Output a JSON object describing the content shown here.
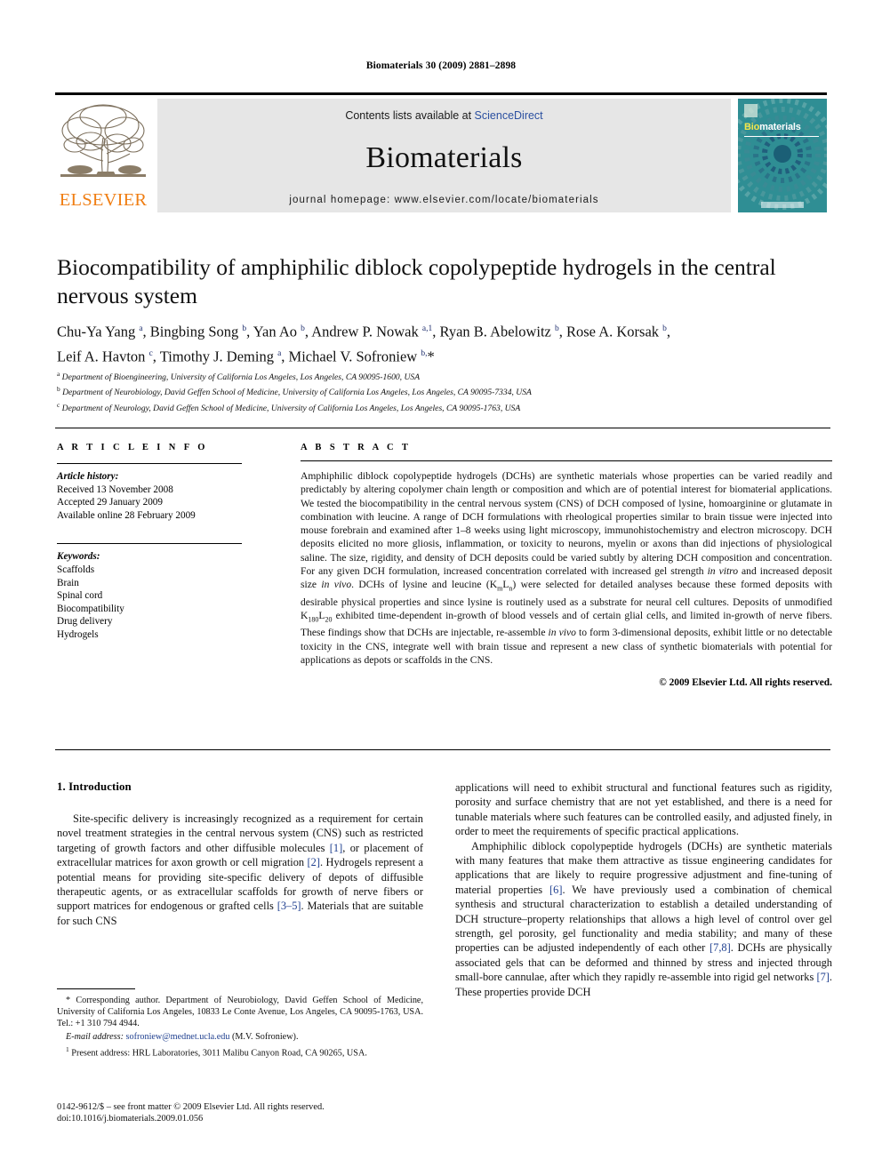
{
  "running_head": "Biomaterials 30 (2009) 2881–2898",
  "masthead": {
    "contents_prefix": "Contents lists available at ",
    "sciencedirect": "ScienceDirect",
    "journal_name": "Biomaterials",
    "homepage": "journal homepage: www.elsevier.com/locate/biomaterials",
    "publisher_logo_text": "ELSEVIER",
    "cover_title_part1": "Bio",
    "cover_title_part2": "materials",
    "accent_orange": "#F07E13",
    "link_blue": "#2a4fa0",
    "cover_teal": "#2a8f93"
  },
  "article": {
    "title": "Biocompatibility of amphiphilic diblock copolypeptide hydrogels in the central nervous system",
    "authors_line1": "Chu-Ya Yang <sup>a</sup>, Bingbing Song <sup>b</sup>, Yan Ao <sup>b</sup>, Andrew P. Nowak <sup>a,1</sup>, Ryan B. Abelowitz <sup>b</sup>, Rose A. Korsak <sup>b</sup>,",
    "authors_line2": "Leif A. Havton <sup>c</sup>, Timothy J. Deming <sup>a</sup>, Michael V. Sofroniew <sup>b,</sup>*",
    "affiliations": [
      "<sup>a</sup> Department of Bioengineering, University of California Los Angeles, Los Angeles, CA 90095-1600, USA",
      "<sup>b</sup> Department of Neurobiology, David Geffen School of Medicine, University of California Los Angeles, Los Angeles, CA 90095-7334, USA",
      "<sup>c</sup> Department of Neurology, David Geffen School of Medicine, University of California Los Angeles, Los Angeles, CA 90095-1763, USA"
    ]
  },
  "article_info": {
    "heading": "A R T I C L E   I N F O",
    "history_label": "Article history:",
    "history": [
      "Received 13 November 2008",
      "Accepted 29 January 2009",
      "Available online 28 February 2009"
    ],
    "keywords_label": "Keywords:",
    "keywords": [
      "Scaffolds",
      "Brain",
      "Spinal cord",
      "Biocompatibility",
      "Drug delivery",
      "Hydrogels"
    ]
  },
  "abstract": {
    "heading": "A B S T R A C T",
    "text": "Amphiphilic diblock copolypeptide hydrogels (DCHs) are synthetic materials whose properties can be varied readily and predictably by altering copolymer chain length or composition and which are of potential interest for biomaterial applications. We tested the biocompatibility in the central nervous system (CNS) of DCH composed of lysine, homoarginine or glutamate in combination with leucine. A range of DCH formulations with rheological properties similar to brain tissue were injected into mouse forebrain and examined after 1–8 weeks using light microscopy, immunohistochemistry and electron microscopy. DCH deposits elicited no more gliosis, inflammation, or toxicity to neurons, myelin or axons than did injections of physiological saline. The size, rigidity, and density of DCH deposits could be varied subtly by altering DCH composition and concentration. For any given DCH formulation, increased concentration correlated with increased gel strength <i>in vitro</i> and increased deposit size <i>in vivo</i>. DCHs of lysine and leucine (K<sub>m</sub>L<sub>n</sub>) were selected for detailed analyses because these formed deposits with desirable physical properties and since lysine is routinely used as a substrate for neural cell cultures. Deposits of unmodified K<sub>180</sub>L<sub>20</sub> exhibited time-dependent in-growth of blood vessels and of certain glial cells, and limited in-growth of nerve fibers. These findings show that DCHs are injectable, re-assemble <i>in vivo</i> to form 3-dimensional deposits, exhibit little or no detectable toxicity in the CNS, integrate well with brain tissue and represent a new class of synthetic biomaterials with potential for applications as depots or scaffolds in the CNS.",
    "copyright": "© 2009 Elsevier Ltd. All rights reserved."
  },
  "introduction": {
    "heading": "1.  Introduction",
    "left_paragraphs": [
      "Site-specific delivery is increasingly recognized as a requirement for certain novel treatment strategies in the central nervous system (CNS) such as restricted targeting of growth factors and other diffusible molecules <span class=\"ref\">[1]</span>, or placement of extracellular matrices for axon growth or cell migration <span class=\"ref\">[2]</span>. Hydrogels represent a potential means for providing site-specific delivery of depots of diffusible therapeutic agents, or as extracellular scaffolds for growth of nerve fibers or support matrices for endogenous or grafted cells <span class=\"ref\">[3–5]</span>. Materials that are suitable for such CNS"
    ],
    "right_paragraphs": [
      "applications will need to exhibit structural and functional features such as rigidity, porosity and surface chemistry that are not yet established, and there is a need for tunable materials where such features can be controlled easily, and adjusted finely, in order to meet the requirements of specific practical applications.",
      "Amphiphilic diblock copolypeptide hydrogels (DCHs) are synthetic materials with many features that make them attractive as tissue engineering candidates for applications that are likely to require progressive adjustment and fine-tuning of material properties <span class=\"ref\">[6]</span>. We have previously used a combination of chemical synthesis and structural characterization to establish a detailed understanding of DCH structure–property relationships that allows a high level of control over gel strength, gel porosity, gel functionality and media stability; and many of these properties can be adjusted independently of each other <span class=\"ref\">[7,8]</span>. DCHs are physically associated gels that can be deformed and thinned by stress and injected through small-bore cannulae, after which they rapidly re-assemble into rigid gel networks <span class=\"ref\">[7]</span>. These properties provide DCH"
    ]
  },
  "footnotes": {
    "corresponding": "* Corresponding author. Department of Neurobiology, David Geffen School of Medicine, University of California Los Angeles, 10833 Le Conte Avenue, Los Angeles, CA 90095-1763, USA. Tel.: +1 310 794 4944.",
    "email_label": "E-mail address:",
    "email": "sofroniew@mednet.ucla.edu",
    "email_owner": "(M.V. Sofroniew).",
    "present_address": "<sup>1</sup>  Present address: HRL Laboratories, 3011 Malibu Canyon Road, CA 90265, USA."
  },
  "imprint": {
    "line1": "0142-9612/$ – see front matter © 2009 Elsevier Ltd. All rights reserved.",
    "line2": "doi:10.1016/j.biomaterials.2009.01.056"
  }
}
